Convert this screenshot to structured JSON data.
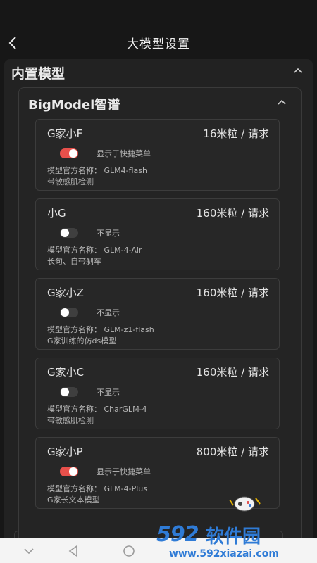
{
  "header": {
    "title": "大模型设置",
    "back_icon": "chevron-left-icon"
  },
  "section": {
    "title": "内置模型",
    "collapse_icon": "chevron-up-icon"
  },
  "provider": {
    "title": "BigModel智谱",
    "collapse_icon": "chevron-up-icon"
  },
  "models": [
    {
      "name": "G家小F",
      "price": "16米粒 / 请求",
      "enabled": true,
      "toggle_label": "显示于快捷菜单",
      "official": "模型官方名称： GLM4-flash",
      "desc": "带敏感肌检测"
    },
    {
      "name": "小G",
      "price": "160米粒 / 请求",
      "enabled": false,
      "toggle_label": "不显示",
      "official": "模型官方名称： GLM-4-Air",
      "desc": "长句、自带刹车"
    },
    {
      "name": "G家小Z",
      "price": "160米粒 / 请求",
      "enabled": false,
      "toggle_label": "不显示",
      "official": "模型官方名称： GLM-z1-flash",
      "desc": "G家训练的仿ds模型"
    },
    {
      "name": "G家小C",
      "price": "160米粒 / 请求",
      "enabled": false,
      "toggle_label": "不显示",
      "official": "模型官方名称： CharGLM-4",
      "desc": "带敏感肌检测"
    },
    {
      "name": "G家小P",
      "price": "800米粒 / 请求",
      "enabled": true,
      "toggle_label": "显示于快捷菜单",
      "official": "模型官方名称： GLM-4-Plus",
      "desc": "G家长文本模型"
    }
  ],
  "colors": {
    "toggle_on": "#e8504b",
    "toggle_off": "#3f3f3f",
    "background": "#171717"
  },
  "watermark": {
    "brand": "592",
    "brand_cn": "软件园",
    "url": "www.592xiazai.com"
  }
}
